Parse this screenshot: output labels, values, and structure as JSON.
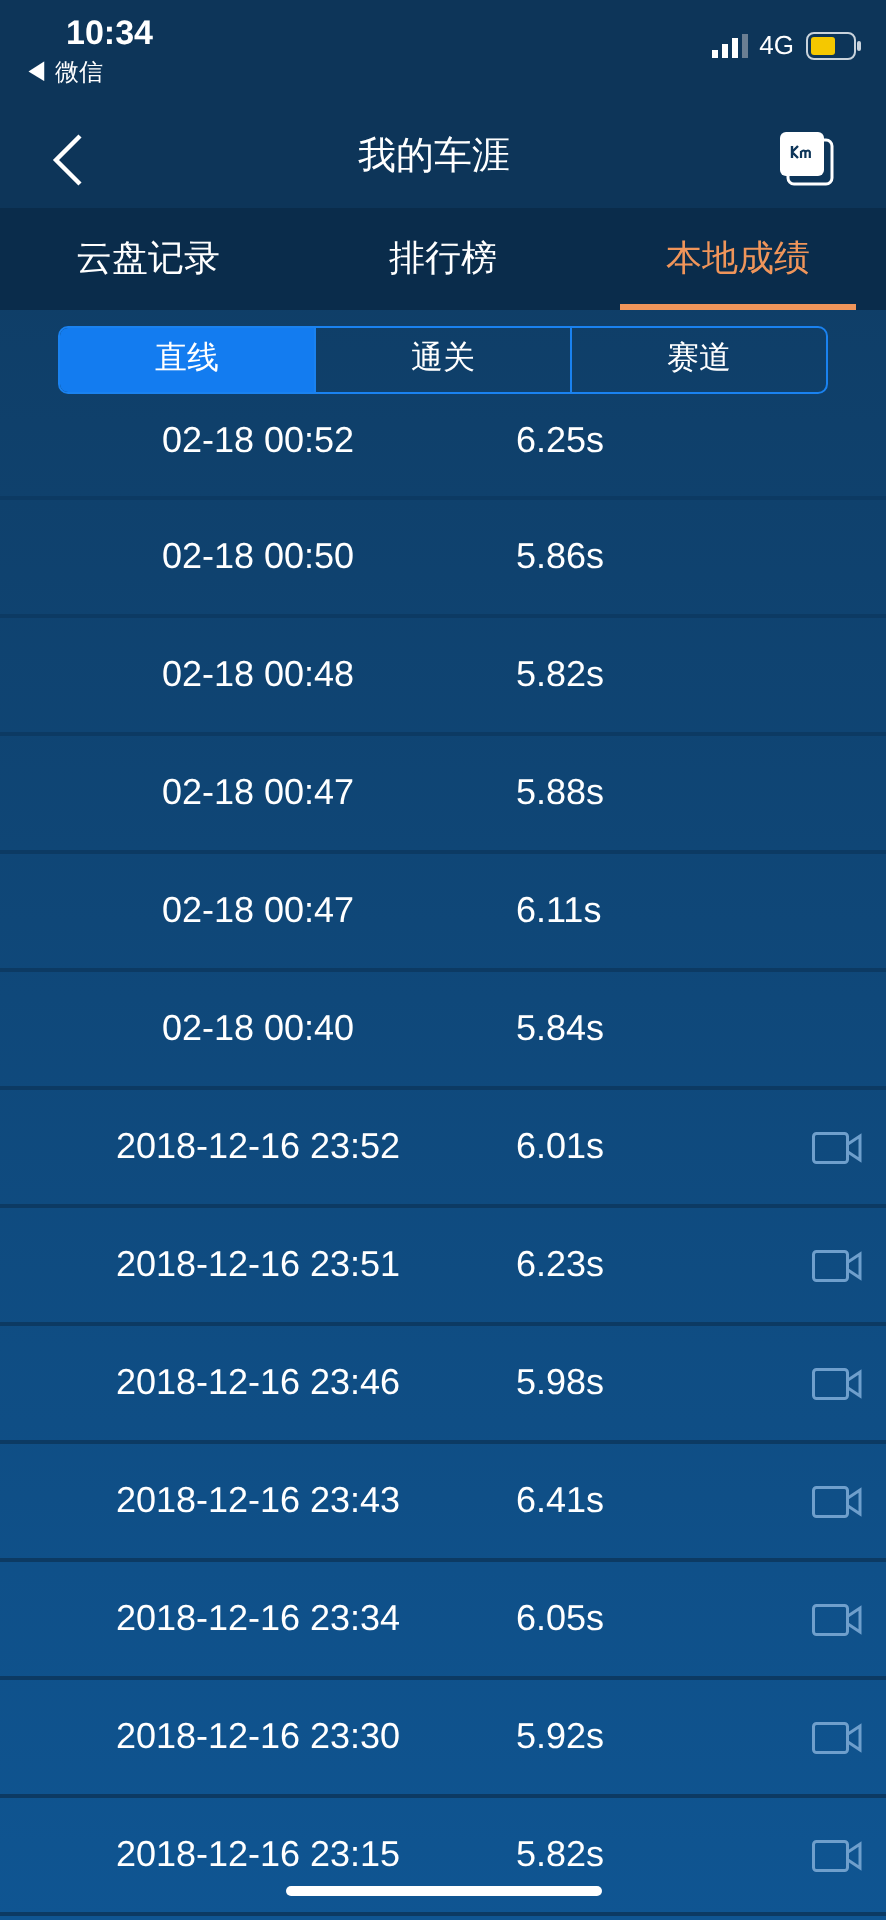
{
  "status_bar": {
    "time": "10:34",
    "back_app": "◀ 微信",
    "network": "4G"
  },
  "nav": {
    "title": "我的车涯"
  },
  "tabs": [
    {
      "label": "云盘记录",
      "selected": false
    },
    {
      "label": "排行榜",
      "selected": false
    },
    {
      "label": "本地成绩",
      "selected": true
    }
  ],
  "segments": [
    {
      "label": "直线",
      "selected": true
    },
    {
      "label": "通关",
      "selected": false
    },
    {
      "label": "赛道",
      "selected": false
    }
  ],
  "records": [
    {
      "date": "02-18 00:52",
      "time": "6.25s",
      "video": false
    },
    {
      "date": "02-18 00:50",
      "time": "5.86s",
      "video": false
    },
    {
      "date": "02-18 00:48",
      "time": "5.82s",
      "video": false
    },
    {
      "date": "02-18 00:47",
      "time": "5.88s",
      "video": false
    },
    {
      "date": "02-18 00:47",
      "time": "6.11s",
      "video": false
    },
    {
      "date": "02-18 00:40",
      "time": "5.84s",
      "video": false
    },
    {
      "date": "2018-12-16 23:52",
      "time": "6.01s",
      "video": true
    },
    {
      "date": "2018-12-16 23:51",
      "time": "6.23s",
      "video": true
    },
    {
      "date": "2018-12-16 23:46",
      "time": "5.98s",
      "video": true
    },
    {
      "date": "2018-12-16 23:43",
      "time": "6.41s",
      "video": true
    },
    {
      "date": "2018-12-16 23:34",
      "time": "6.05s",
      "video": true
    },
    {
      "date": "2018-12-16 23:30",
      "time": "5.92s",
      "video": true
    },
    {
      "date": "2018-12-16 23:15",
      "time": "5.82s",
      "video": true
    }
  ]
}
